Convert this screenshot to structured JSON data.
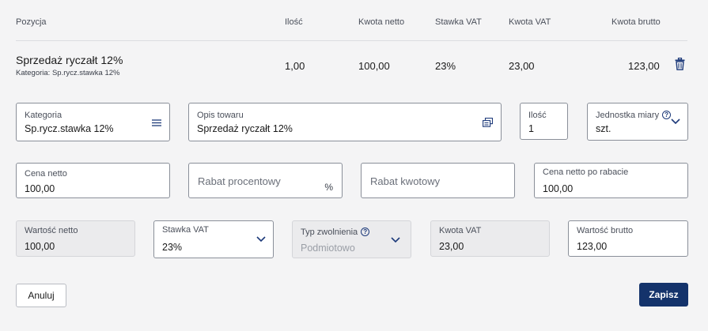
{
  "table": {
    "headers": {
      "position": "Pozycja",
      "quantity": "Ilość",
      "net_amount": "Kwota netto",
      "vat_rate": "Stawka VAT",
      "vat_amount": "Kwota VAT",
      "gross_amount": "Kwota brutto"
    },
    "row": {
      "title": "Sprzedaż ryczałt 12%",
      "category": "Kategoria: Sp.rycz.stawka 12%",
      "quantity": "1,00",
      "net_amount": "100,00",
      "vat_rate": "23%",
      "vat_amount": "23,00",
      "gross_amount": "123,00"
    }
  },
  "form": {
    "category": {
      "label": "Kategoria",
      "value": "Sp.rycz.stawka 12%"
    },
    "description": {
      "label": "Opis towaru",
      "value": "Sprzedaż ryczałt 12%"
    },
    "quantity": {
      "label": "Ilość",
      "value": "1"
    },
    "unit": {
      "label": "Jednostka miary",
      "value": "szt."
    },
    "net_price": {
      "label": "Cena netto",
      "value": "100,00"
    },
    "discount_percent": {
      "placeholder": "Rabat procentowy",
      "suffix": "%"
    },
    "discount_amount": {
      "placeholder": "Rabat kwotowy"
    },
    "net_price_after_discount": {
      "label": "Cena netto po rabacie",
      "value": "100,00"
    },
    "net_value": {
      "label": "Wartość netto",
      "value": "100,00"
    },
    "vat_rate": {
      "label": "Stawka VAT",
      "value": "23%"
    },
    "exemption_type": {
      "label": "Typ zwolnienia",
      "value": "Podmiotowo"
    },
    "vat_amount": {
      "label": "Kwota VAT",
      "value": "23,00"
    },
    "gross_value": {
      "label": "Wartość brutto",
      "value": "123,00"
    }
  },
  "actions": {
    "cancel_label": "Anuluj",
    "save_label": "Zapisz"
  },
  "icons": {
    "info_glyph": "?"
  },
  "colors": {
    "primary": "#14336b",
    "background": "#f4f4f5",
    "disabled_field": "#ebebed"
  }
}
